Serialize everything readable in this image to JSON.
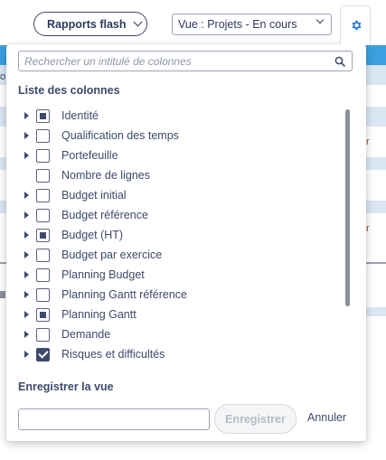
{
  "toolbar": {
    "flash_label": "Rapports flash",
    "view_select_value": "Vue : Projets - En cours"
  },
  "background": {
    "left_fragment": "o",
    "right_fragment_1": "r",
    "right_fragment_2": "r"
  },
  "panel": {
    "search_placeholder": "Rechercher un intitulé de colonnes",
    "columns_title": "Liste des colonnes",
    "columns": [
      {
        "label": "Identité",
        "expandable": true,
        "state": "partial"
      },
      {
        "label": "Qualification des temps",
        "expandable": true,
        "state": "unchecked"
      },
      {
        "label": "Portefeuille",
        "expandable": true,
        "state": "unchecked"
      },
      {
        "label": "Nombre de lignes",
        "expandable": false,
        "state": "unchecked"
      },
      {
        "label": "Budget initial",
        "expandable": true,
        "state": "unchecked"
      },
      {
        "label": "Budget référence",
        "expandable": true,
        "state": "unchecked"
      },
      {
        "label": "Budget (HT)",
        "expandable": true,
        "state": "partial"
      },
      {
        "label": "Budget par exercice",
        "expandable": true,
        "state": "unchecked"
      },
      {
        "label": "Planning Budget",
        "expandable": true,
        "state": "unchecked"
      },
      {
        "label": "Planning Gantt référence",
        "expandable": true,
        "state": "unchecked"
      },
      {
        "label": "Planning Gantt",
        "expandable": true,
        "state": "partial"
      },
      {
        "label": "Demande",
        "expandable": true,
        "state": "unchecked"
      },
      {
        "label": "Risques et difficultés",
        "expandable": true,
        "state": "checked"
      }
    ],
    "save_title": "Enregistrer la vue",
    "save_input_value": "",
    "save_button": "Enregistrer",
    "cancel_button": "Annuler"
  },
  "colors": {
    "primary": "#3d4a6b",
    "accent": "#2f7fd6",
    "header_bar": "#3aa0e0"
  }
}
